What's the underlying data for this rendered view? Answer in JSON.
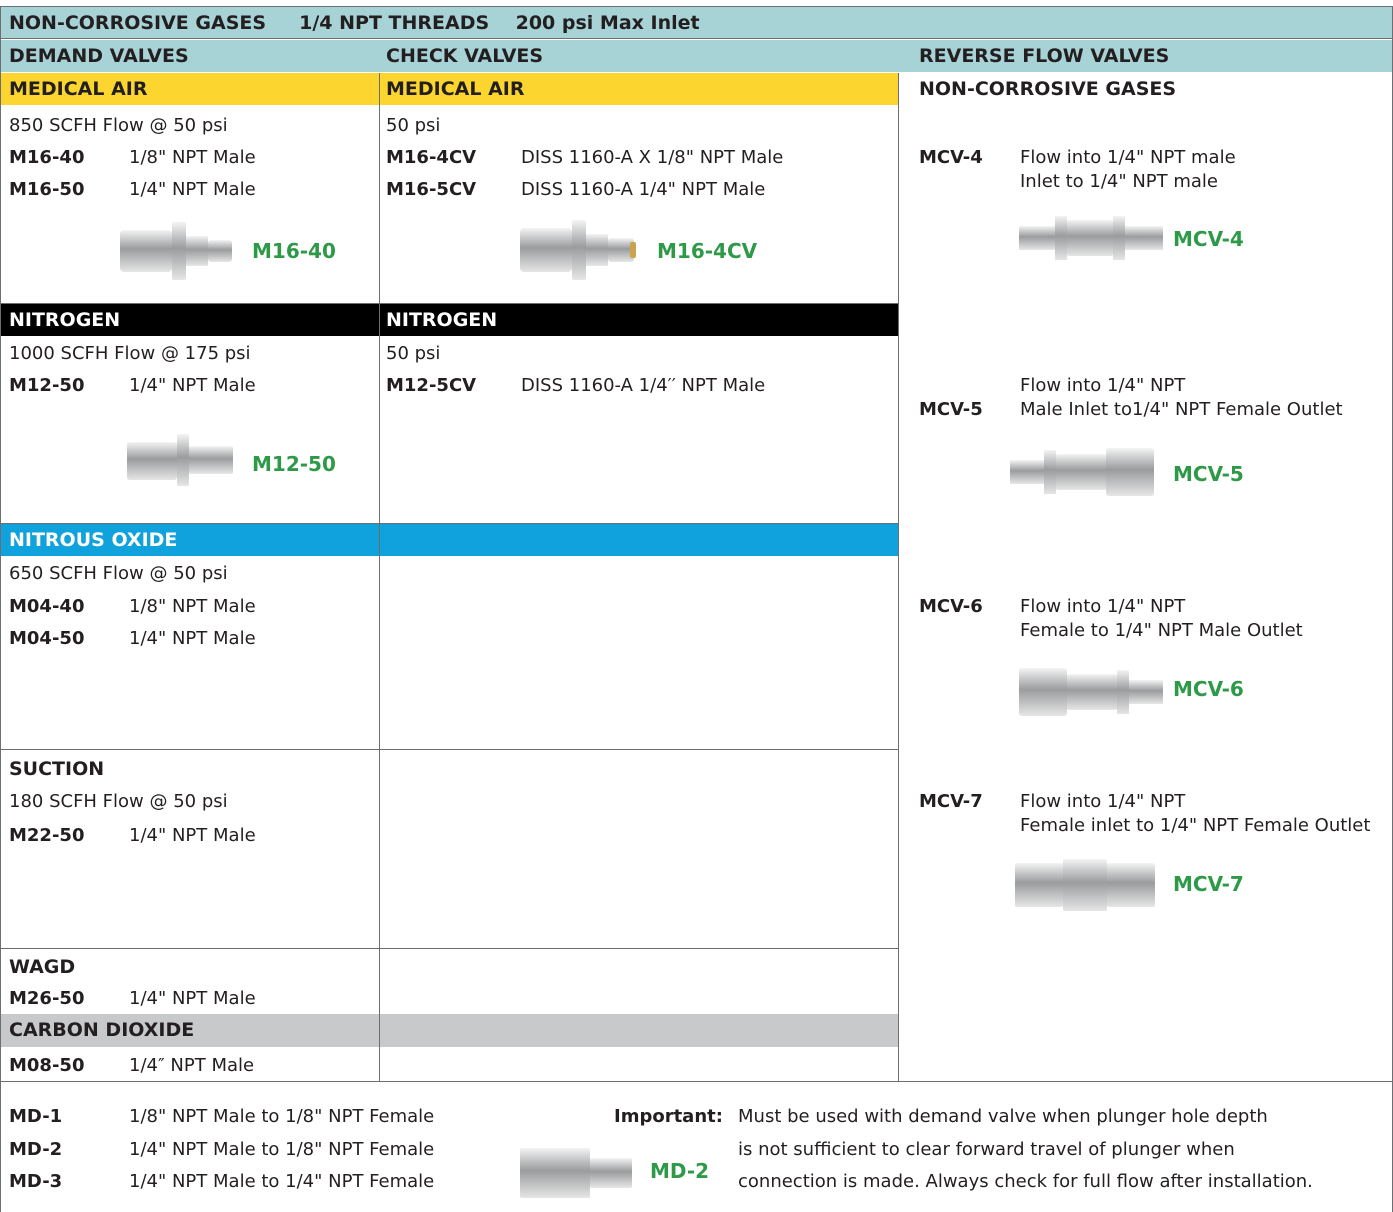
{
  "header": {
    "title": "NON-CORROSIVE GASES     1/4 NPT THREADS    200 psi Max Inlet"
  },
  "columns": {
    "demand": "DEMAND VALVES",
    "check": "CHECK VALVES",
    "reverse": "REVERSE FLOW VALVES"
  },
  "demand": {
    "medical_air": {
      "title": "MEDICAL AIR",
      "spec": "850 SCFH Flow @ 50 psi",
      "items": [
        {
          "model": "M16-40",
          "desc": "1/8\" NPT Male"
        },
        {
          "model": "M16-50",
          "desc": "1/4\" NPT Male"
        }
      ],
      "caption": "M16-40"
    },
    "nitrogen": {
      "title": "NITROGEN",
      "spec": "1000 SCFH Flow @ 175 psi",
      "items": [
        {
          "model": "M12-50",
          "desc": "1/4\" NPT Male"
        }
      ],
      "caption": "M12-50"
    },
    "nitrous": {
      "title": "NITROUS OXIDE",
      "spec": "650 SCFH Flow @ 50 psi",
      "items": [
        {
          "model": "M04-40",
          "desc": "1/8\" NPT Male"
        },
        {
          "model": "M04-50",
          "desc": "1/4\" NPT Male"
        }
      ]
    },
    "suction": {
      "title": "SUCTION",
      "spec": "180 SCFH Flow @ 50 psi",
      "items": [
        {
          "model": "M22-50",
          "desc": "1/4\" NPT Male"
        }
      ]
    },
    "wagd": {
      "title": "WAGD",
      "items": [
        {
          "model": "M26-50",
          "desc": "1/4\" NPT Male"
        }
      ]
    },
    "co2": {
      "title": "CARBON DIOXIDE",
      "items": [
        {
          "model": "M08-50",
          "desc": "1/4″ NPT Male"
        }
      ]
    }
  },
  "check": {
    "medical_air": {
      "title": "MEDICAL AIR",
      "spec": "50 psi",
      "items": [
        {
          "model": "M16-4CV",
          "desc": "DISS 1160-A X 1/8\" NPT Male"
        },
        {
          "model": "M16-5CV",
          "desc": "DISS 1160-A 1/4\" NPT Male"
        }
      ],
      "caption": "M16-4CV"
    },
    "nitrogen": {
      "title": "NITROGEN",
      "spec": "50 psi",
      "items": [
        {
          "model": "M12-5CV",
          "desc": "DISS 1160-A 1/4′′ NPT Male"
        }
      ]
    }
  },
  "reverse": {
    "subtitle": "NON-CORROSIVE GASES",
    "items": [
      {
        "model": "MCV-4",
        "line1": "Flow into 1/4\" NPT male",
        "line2": "Inlet to 1/4\" NPT male",
        "caption": "MCV-4"
      },
      {
        "model": "MCV-5",
        "line1": "Flow into 1/4\" NPT",
        "line2": "Male Inlet to1/4\" NPT Female Outlet",
        "caption": "MCV-5"
      },
      {
        "model": "MCV-6",
        "line1": "Flow into 1/4\" NPT",
        "line2": "Female to 1/4\" NPT Male Outlet",
        "caption": "MCV-6"
      },
      {
        "model": "MCV-7",
        "line1": "Flow into 1/4\" NPT",
        "line2": "Female inlet to 1/4\" NPT Female Outlet",
        "caption": "MCV-7"
      }
    ]
  },
  "adapters": {
    "items": [
      {
        "model": "MD-1",
        "desc": "1/8\" NPT Male to 1/8\" NPT Female"
      },
      {
        "model": "MD-2",
        "desc": "1/4\" NPT Male to 1/8\" NPT Female"
      },
      {
        "model": "MD-3",
        "desc": "1/4\" NPT Male to 1/4\" NPT Female"
      }
    ],
    "caption": "MD-2",
    "important_label": "Important:",
    "important_lines": [
      "Must be used with demand valve when plunger hole depth",
      "is not sufficient to clear forward travel of plunger when",
      "connection is made. Always check for full flow after installation."
    ]
  },
  "colors": {
    "header_teal": "#a7d2d6",
    "medical_air": "#fcd62f",
    "nitrogen": "#000000",
    "nitrous": "#10a2dc",
    "co2": "#c8c9cb",
    "caption_green": "#2e9a48"
  }
}
